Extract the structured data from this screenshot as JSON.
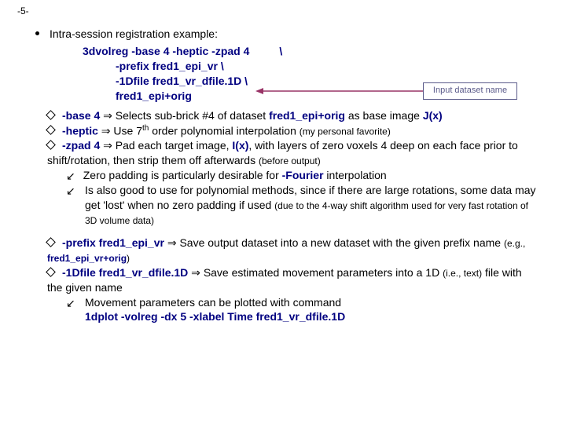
{
  "page_number": "-5-",
  "title": "Intra-session registration example:",
  "code": {
    "l1a": "3dvolreg -base 4 -heptic -zpad 4",
    "l1b": "\\",
    "l2": "-prefix fred1_epi_vr   \\",
    "l3": "-1Dfile fred1_vr_dfile.1D \\",
    "l4": "fred1_epi+orig"
  },
  "callout": "Input dataset name",
  "b1": {
    "opt": "-base 4",
    "arrow": " ⇒ ",
    "t1": "Selects sub-brick #4 of dataset ",
    "ds": "fred1_epi+orig",
    "t2": " as base image ",
    "jx": "J(x)"
  },
  "b2": {
    "opt": "-heptic",
    "arrow": " ⇒ ",
    "t1": "Use 7",
    "sup": "th",
    "t2": " order polynomial interpolation ",
    "note": "(my personal favorite)"
  },
  "b3": {
    "opt": "-zpad 4",
    "arrow": " ⇒ ",
    "t1": "Pad each target image, ",
    "ix": "I(x)",
    "t2": ", with layers of zero voxels 4 deep on each face prior to shift/rotation, then strip them off afterwards ",
    "note": "(before output)"
  },
  "b3s1": {
    "t1": "Zero padding is particularly desirable for ",
    "opt": "-Fourier",
    "t2": " interpolation"
  },
  "b3s2": {
    "t1": "Is also good to use for polynomial methods, since if there are large rotations, some data may get 'lost' when no zero padding if used ",
    "note": "(due to the 4-way shift algorithm used for very fast rotation of 3D volume data)"
  },
  "b4": {
    "opt": "-prefix fred1_epi_vr",
    "arrow": " ⇒ ",
    "t1": "Save output dataset into a new dataset with the given prefix name ",
    "eg1": "(e.g., ",
    "ds": "fred1_epi_vr+orig",
    "eg2": ")"
  },
  "b5": {
    "opt": "-1Dfile fred1_vr_dfile.1D",
    "arrow": " ⇒ ",
    "t1": "Save estimated movement parameters into a 1D ",
    "note": "(i.e., text)",
    "t2": " file with the given name"
  },
  "b5s1": {
    "t1": "Movement parameters can be plotted with command",
    "cmd": "1dplot -volreg -dx 5 -xlabel Time fred1_vr_dfile.1D"
  }
}
